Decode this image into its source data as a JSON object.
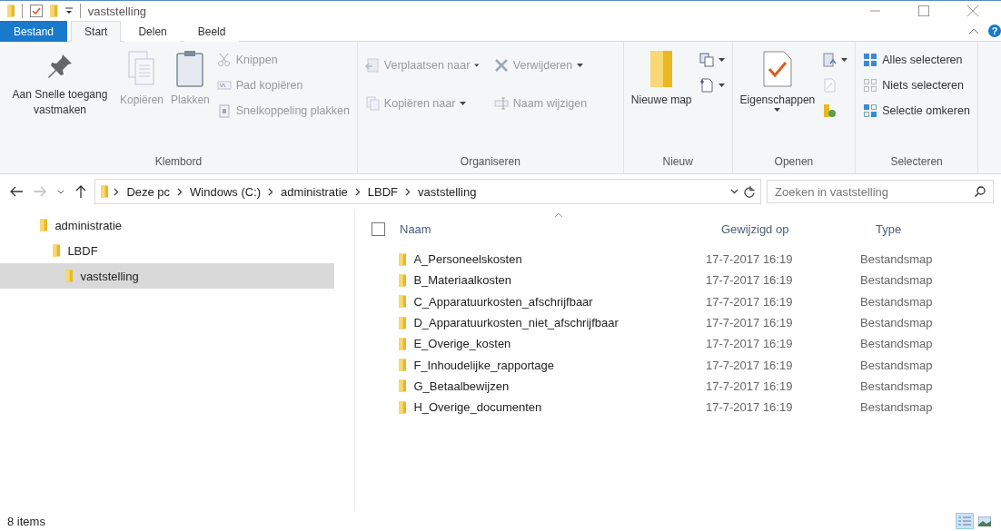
{
  "window": {
    "title": "vaststelling",
    "help": "?"
  },
  "tabs": [
    {
      "label": "Bestand",
      "kind": "file",
      "selected": false
    },
    {
      "label": "Start",
      "kind": "tab",
      "selected": true
    },
    {
      "label": "Delen",
      "kind": "tab",
      "selected": false
    },
    {
      "label": "Beeld",
      "kind": "tab",
      "selected": false
    }
  ],
  "ribbon": [
    {
      "label": "Klembord",
      "large": [
        {
          "label": "Aan Snelle toegang vastmaken",
          "disabled": false,
          "dropdown": false
        },
        {
          "label": "Kopiëren",
          "disabled": true,
          "dropdown": false
        },
        {
          "label": "Plakken",
          "disabled": true,
          "dropdown": false
        }
      ],
      "small": [
        {
          "label": "Knippen",
          "disabled": true,
          "dropdown": false
        },
        {
          "label": "Pad kopiëren",
          "disabled": true,
          "dropdown": false
        },
        {
          "label": "Snelkoppeling plakken",
          "disabled": true,
          "dropdown": false
        }
      ]
    },
    {
      "label": "Organiseren",
      "small": [
        {
          "label": "Verplaatsen naar",
          "disabled": true,
          "dropdown": true
        },
        {
          "label": "Kopiëren naar",
          "disabled": true,
          "dropdown": true
        },
        {
          "label": "Verwijderen",
          "disabled": true,
          "dropdown": true
        },
        {
          "label": "Naam wijzigen",
          "disabled": true,
          "dropdown": false
        }
      ]
    },
    {
      "label": "Nieuw",
      "large": [
        {
          "label": "Nieuwe map",
          "disabled": false,
          "dropdown": false
        }
      ],
      "small": [
        {
          "disabled": false,
          "dropdown": true
        },
        {
          "disabled": false,
          "dropdown": true
        }
      ]
    },
    {
      "label": "Openen",
      "large": [
        {
          "label": "Eigenschappen",
          "disabled": false,
          "dropdown": true
        }
      ],
      "small": [
        {
          "disabled": false,
          "dropdown": true
        },
        {
          "disabled": true,
          "dropdown": false
        },
        {
          "disabled": false,
          "dropdown": false
        }
      ]
    },
    {
      "label": "Selecteren",
      "small": [
        {
          "label": "Alles selecteren",
          "disabled": false,
          "dropdown": false
        },
        {
          "label": "Niets selecteren",
          "disabled": false,
          "dropdown": false
        },
        {
          "label": "Selectie omkeren",
          "disabled": false,
          "dropdown": false
        }
      ]
    }
  ],
  "address": {
    "crumbs": [
      "Deze pc",
      "Windows (C:)",
      "administratie",
      "LBDF",
      "vaststelling"
    ],
    "search_placeholder": "Zoeken in vaststelling"
  },
  "tree": [
    {
      "label": "administratie",
      "selected": false,
      "children": [
        {
          "label": "LBDF",
          "selected": false,
          "children": [
            {
              "label": "vaststelling",
              "selected": true
            }
          ]
        }
      ]
    }
  ],
  "table": {
    "select_all_checked": false,
    "columns": [
      {
        "label": "Naam",
        "sorted": true
      },
      {
        "label": "Gewijzigd op",
        "sorted": false
      },
      {
        "label": "Type",
        "sorted": false
      }
    ],
    "rows": [
      [
        "A_Personeelskosten",
        "17-7-2017 16:19",
        "Bestandsmap"
      ],
      [
        "B_Materiaalkosten",
        "17-7-2017 16:19",
        "Bestandsmap"
      ],
      [
        "C_Apparatuurkosten_afschrijfbaar",
        "17-7-2017 16:19",
        "Bestandsmap"
      ],
      [
        "D_Apparatuurkosten_niet_afschrijfbaar",
        "17-7-2017 16:19",
        "Bestandsmap"
      ],
      [
        "E_Overige_kosten",
        "17-7-2017 16:19",
        "Bestandsmap"
      ],
      [
        "F_Inhoudelijke_rapportage",
        "17-7-2017 16:19",
        "Bestandsmap"
      ],
      [
        "G_Betaalbewijzen",
        "17-7-2017 16:19",
        "Bestandsmap"
      ],
      [
        "H_Overige_documenten",
        "17-7-2017 16:19",
        "Bestandsmap"
      ]
    ]
  },
  "status_bar": {
    "count": "8 items",
    "views": [
      {
        "kind": "details",
        "selected": true
      },
      {
        "kind": "large",
        "selected": false
      }
    ]
  }
}
